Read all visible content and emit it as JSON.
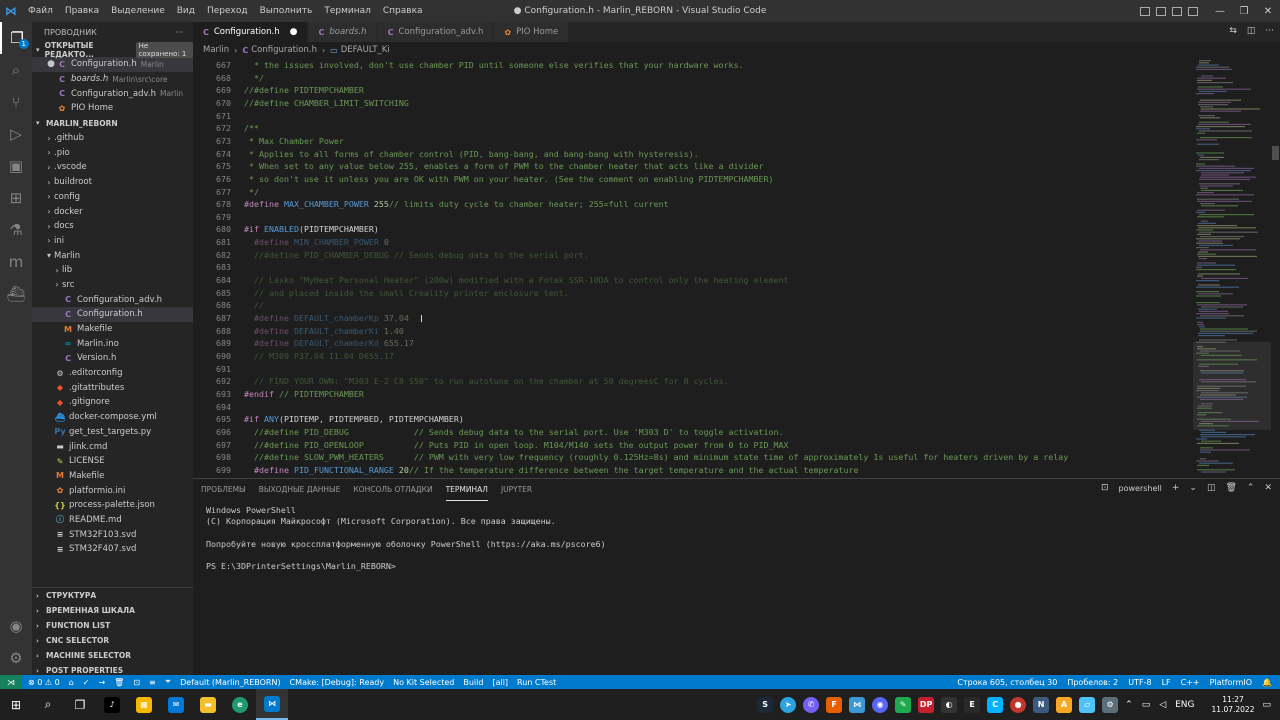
{
  "window": {
    "title": "● Configuration.h - Marlin_REBORN - Visual Studio Code",
    "menu": [
      "Файл",
      "Правка",
      "Выделение",
      "Вид",
      "Переход",
      "Выполнить",
      "Терминал",
      "Справка"
    ],
    "controls": [
      "—",
      "❐",
      "✕"
    ]
  },
  "activity": {
    "items": [
      "explorer",
      "search",
      "source-control",
      "run-debug",
      "remote-explorer",
      "extensions",
      "testing",
      "platformio",
      "docker"
    ],
    "badge": "1"
  },
  "sidebar": {
    "title": "ПРОВОДНИК",
    "open_editors": {
      "label": "ОТКРЫТЫЕ РЕДАКТО...",
      "unsaved": "Не сохранено: 1",
      "files": [
        {
          "name": "Configuration.h",
          "desc": "Marlin",
          "icon": "C",
          "modified": true
        },
        {
          "name": "boards.h",
          "desc": "Marlin\\src\\core",
          "icon": "C",
          "modified": false
        },
        {
          "name": "Configuration_adv.h",
          "desc": "Marlin",
          "icon": "C",
          "modified": false
        },
        {
          "name": "PIO Home",
          "desc": "",
          "icon": "pio",
          "modified": false
        }
      ]
    },
    "project": {
      "label": "MARLIN_REBORN",
      "tree": [
        {
          "name": ".github",
          "type": "folder",
          "depth": 1,
          "open": false
        },
        {
          "name": ".pio",
          "type": "folder",
          "depth": 1,
          "open": false
        },
        {
          "name": ".vscode",
          "type": "folder",
          "depth": 1,
          "open": false
        },
        {
          "name": "buildroot",
          "type": "folder",
          "depth": 1,
          "open": false
        },
        {
          "name": "config",
          "type": "folder",
          "depth": 1,
          "open": false
        },
        {
          "name": "docker",
          "type": "folder",
          "depth": 1,
          "open": false
        },
        {
          "name": "docs",
          "type": "folder",
          "depth": 1,
          "open": false
        },
        {
          "name": "ini",
          "type": "folder",
          "depth": 1,
          "open": false
        },
        {
          "name": "Marlin",
          "type": "folder",
          "depth": 1,
          "open": true
        },
        {
          "name": "lib",
          "type": "folder",
          "depth": 2,
          "open": false
        },
        {
          "name": "src",
          "type": "folder",
          "depth": 2,
          "open": false
        },
        {
          "name": "Configuration_adv.h",
          "type": "c",
          "depth": 2
        },
        {
          "name": "Configuration.h",
          "type": "c",
          "depth": 2,
          "selected": true
        },
        {
          "name": "Makefile",
          "type": "make",
          "depth": 2
        },
        {
          "name": "Marlin.ino",
          "type": "ino",
          "depth": 2
        },
        {
          "name": "Version.h",
          "type": "c",
          "depth": 2
        },
        {
          "name": ".editorconfig",
          "type": "gear",
          "depth": 1
        },
        {
          "name": ".gitattributes",
          "type": "git",
          "depth": 1
        },
        {
          "name": ".gitignore",
          "type": "git",
          "depth": 1
        },
        {
          "name": "docker-compose.yml",
          "type": "docker",
          "depth": 1
        },
        {
          "name": "get_test_targets.py",
          "type": "py",
          "depth": 1
        },
        {
          "name": "jlink.cmd",
          "type": "cmd",
          "depth": 1
        },
        {
          "name": "LICENSE",
          "type": "license",
          "depth": 1
        },
        {
          "name": "Makefile",
          "type": "make",
          "depth": 1
        },
        {
          "name": "platformio.ini",
          "type": "pio",
          "depth": 1
        },
        {
          "name": "process-palette.json",
          "type": "json",
          "depth": 1
        },
        {
          "name": "README.md",
          "type": "md",
          "depth": 1
        },
        {
          "name": "STM32F103.svd",
          "type": "svd",
          "depth": 1
        },
        {
          "name": "STM32F407.svd",
          "type": "svd",
          "depth": 1
        }
      ]
    },
    "sections": [
      "СТРУКТУРА",
      "ВРЕМЕННАЯ ШКАЛА",
      "FUNCTION LIST",
      "CNC SELECTOR",
      "MACHINE SELECTOR",
      "POST PROPERTIES"
    ]
  },
  "tabs": [
    {
      "label": "Configuration.h",
      "active": true,
      "modified": true
    },
    {
      "label": "boards.h",
      "active": false,
      "italic": true
    },
    {
      "label": "Configuration_adv.h",
      "active": false
    },
    {
      "label": "PIO Home",
      "active": false
    }
  ],
  "breadcrumb": [
    "Marlin",
    "Configuration.h",
    "DEFAULT_Ki"
  ],
  "editor": {
    "lines": [
      {
        "n": "667",
        "t": "  * the issues involved, don't use chamber PID until someone else verifies that your hardware works."
      },
      {
        "n": "668",
        "t": "  */"
      },
      {
        "n": "669",
        "t": "//#define PIDTEMPCHAMBER"
      },
      {
        "n": "670",
        "t": "//#define CHAMBER_LIMIT_SWITCHING"
      },
      {
        "n": "671",
        "t": ""
      },
      {
        "n": "672",
        "t": "/**"
      },
      {
        "n": "673",
        "t": " * Max Chamber Power"
      },
      {
        "n": "674",
        "t": " * Applies to all forms of chamber control (PID, bang-bang, and bang-bang with hysteresis)."
      },
      {
        "n": "675",
        "t": " * When set to any value below 255, enables a form of PWM to the chamber heater that acts like a divider"
      },
      {
        "n": "676",
        "t": " * so don't use it unless you are OK with PWM on your heater. (See the comment on enabling PIDTEMPCHAMBER)"
      },
      {
        "n": "677",
        "t": " */"
      },
      {
        "n": "678",
        "t": "#define MAX_CHAMBER_POWER 255 // limits duty cycle to chamber heater; 255=full current"
      },
      {
        "n": "679",
        "t": ""
      },
      {
        "n": "680",
        "t": "#if ENABLED(PIDTEMPCHAMBER)"
      },
      {
        "n": "681",
        "t": "  #define MIN_CHAMBER_POWER 0"
      },
      {
        "n": "682",
        "t": "  //#define PID_CHAMBER_DEBUG // Sends debug data to the serial port."
      },
      {
        "n": "683",
        "t": ""
      },
      {
        "n": "684",
        "t": "  // Lasko \"MyHeat Personal Heater\" (200w) modified with a Fotek SSR-10DA to control only the heating element"
      },
      {
        "n": "685",
        "t": "  // and placed inside the small Creality printer enclosure tent."
      },
      {
        "n": "686",
        "t": "  //"
      },
      {
        "n": "687",
        "t": "  #define DEFAULT_chamberKp 37.04"
      },
      {
        "n": "688",
        "t": "  #define DEFAULT_chamberKi 1.40"
      },
      {
        "n": "689",
        "t": "  #define DEFAULT_chamberKd 655.17"
      },
      {
        "n": "690",
        "t": "  // M309 P37.04 I1.04 D655.17"
      },
      {
        "n": "691",
        "t": ""
      },
      {
        "n": "692",
        "t": "  // FIND YOUR OWN: \"M303 E-2 C8 S50\" to run autotune on the chamber at 50 degreesC for 8 cycles."
      },
      {
        "n": "693",
        "t": "#endif // PIDTEMPCHAMBER"
      },
      {
        "n": "694",
        "t": ""
      },
      {
        "n": "695",
        "t": "#if ANY(PIDTEMP, PIDTEMPBED, PIDTEMPCHAMBER)"
      },
      {
        "n": "696",
        "t": "  //#define PID_DEBUG             // Sends debug data to the serial port. Use 'M303 D' to toggle activation."
      },
      {
        "n": "697",
        "t": "  //#define PID_OPENLOOP          // Puts PID in open loop. M104/M140 sets the output power from 0 to PID_MAX"
      },
      {
        "n": "698",
        "t": "  //#define SLOW_PWM_HEATERS      // PWM with very low frequency (roughly 0.125Hz=8s) and minimum state time of approximately 1s useful for heaters driven by a relay"
      },
      {
        "n": "699",
        "t": "  #define PID_FUNCTIONAL_RANGE 20 // If the temperature difference between the target temperature and the actual temperature"
      }
    ]
  },
  "panel": {
    "tabs": [
      "ПРОБЛЕМЫ",
      "ВЫХОДНЫЕ ДАННЫЕ",
      "КОНСОЛЬ ОТЛАДКИ",
      "ТЕРМИНАЛ",
      "JUPYTER"
    ],
    "active_tab": "ТЕРМИНАЛ",
    "shell": "powershell",
    "terminal_lines": [
      "Windows PowerShell",
      "(C) Корпорация Майкрософт (Microsoft Corporation). Все права защищены.",
      "",
      "Попробуйте новую кроссплатформенную оболочку PowerShell (https://aka.ms/pscore6)",
      "",
      "PS E:\\3DPrinterSettings\\Marlin_REBORN>"
    ]
  },
  "statusbar": {
    "left": [
      "⊗ 0 ⚠ 0",
      "⌂",
      "✓",
      "→",
      "🗑",
      "⊡",
      "≡",
      "⏷",
      "Default (Marlin_REBORN)",
      "CMake: [Debug]: Ready",
      "No Kit Selected",
      "Build",
      "[all]",
      "Run CTest"
    ],
    "right": [
      "Строка 605, столбец 30",
      "Пробелов: 2",
      "UTF-8",
      "LF",
      "C++",
      "PlatformIO"
    ]
  },
  "taskbar": {
    "time": "11:27",
    "date": "11.07.2022",
    "lang": "ENG"
  }
}
